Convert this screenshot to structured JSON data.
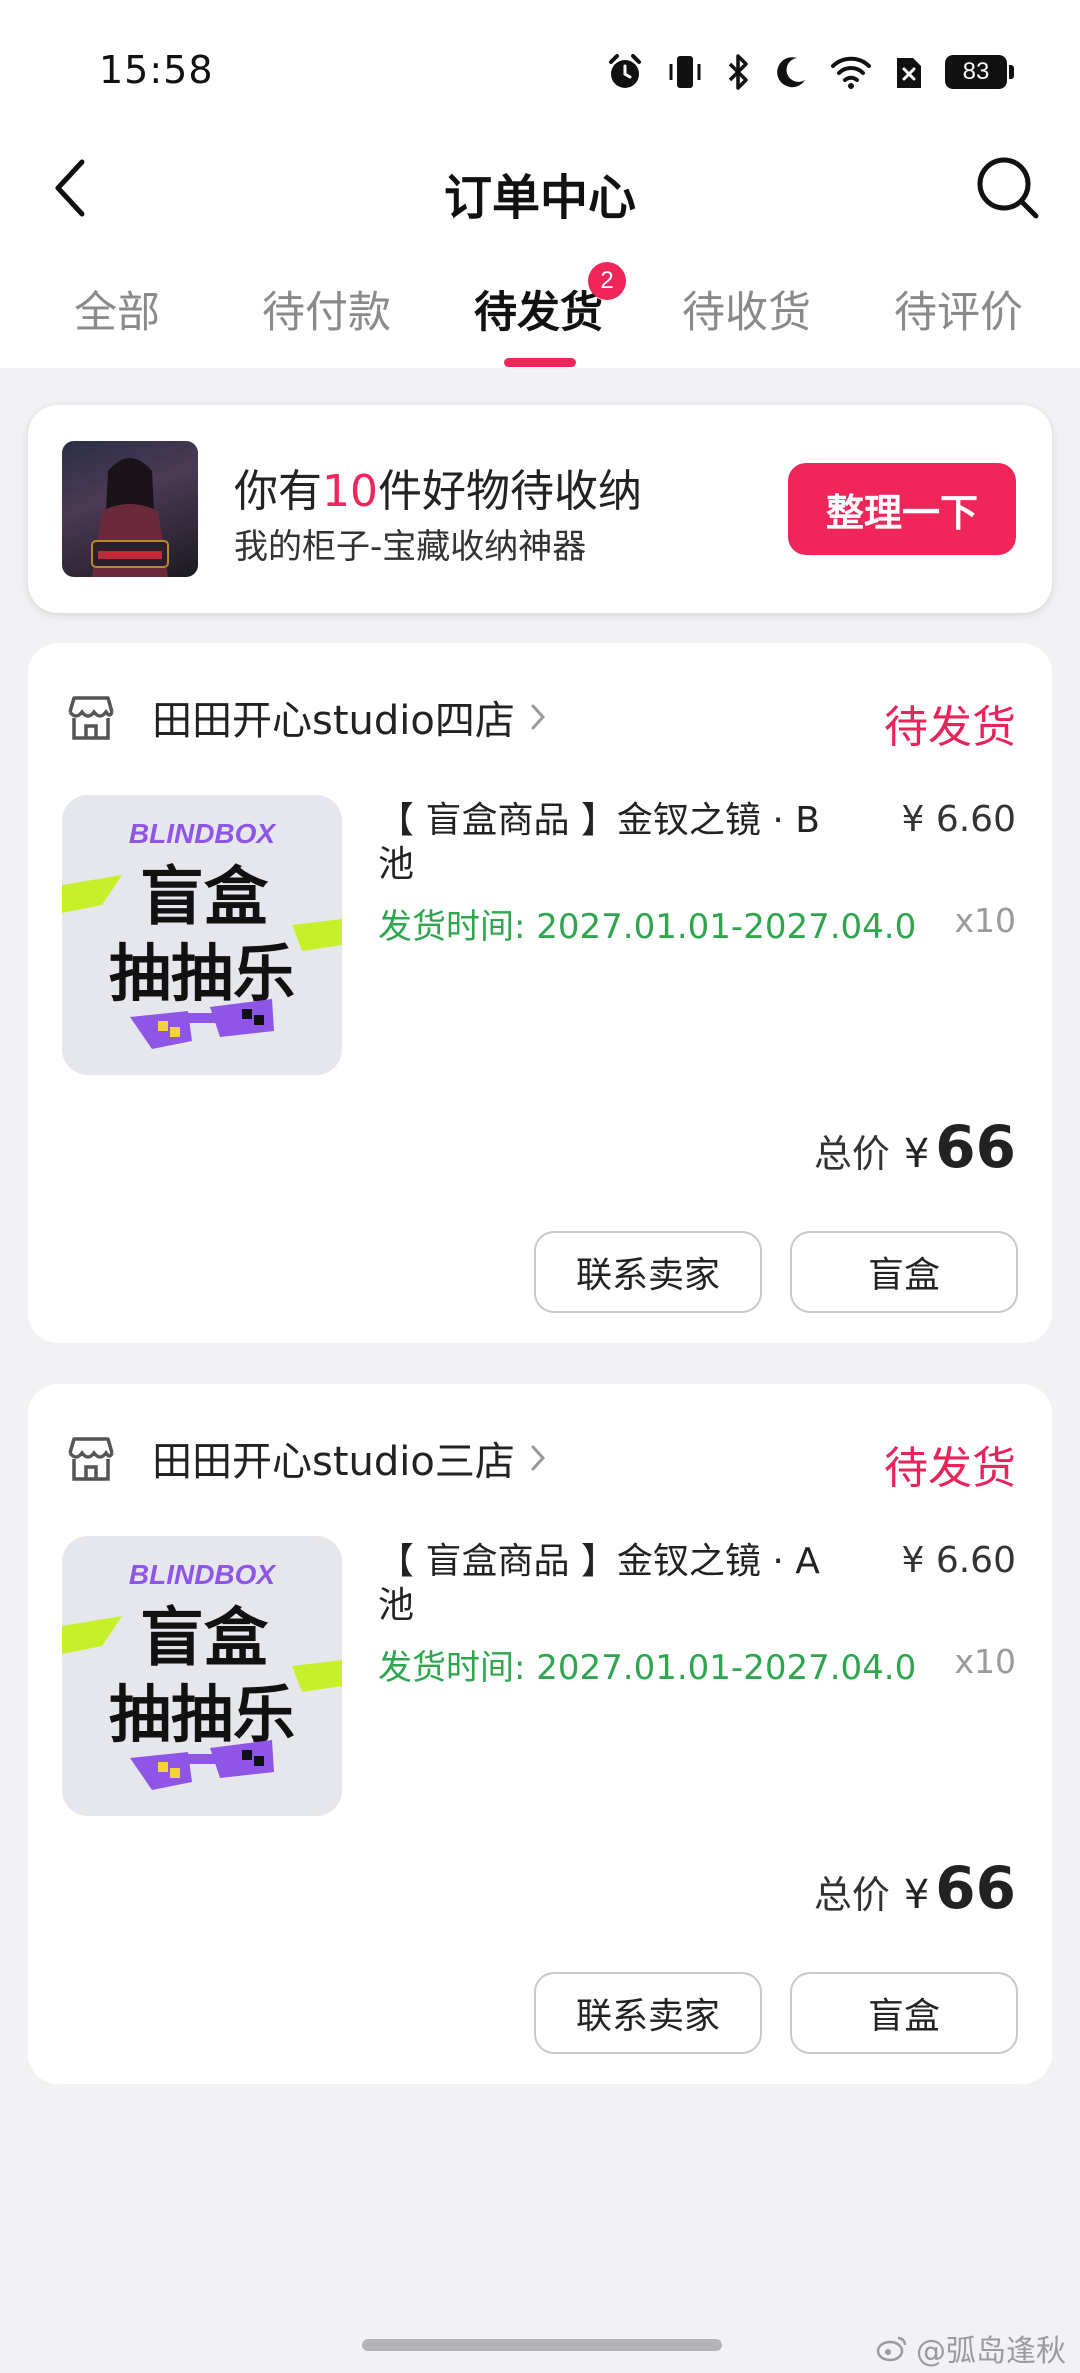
{
  "status_bar": {
    "time": "15:58",
    "battery": "83"
  },
  "header": {
    "title": "订单中心"
  },
  "tabs": {
    "items": [
      {
        "label": "全部"
      },
      {
        "label": "待付款"
      },
      {
        "label": "待发货"
      },
      {
        "label": "待收货"
      },
      {
        "label": "待评价"
      }
    ],
    "active": "待发货",
    "badge": "2"
  },
  "banner": {
    "title_prefix": "你有",
    "title_count": "10",
    "title_suffix": "件好物待收纳",
    "subtitle": "我的柜子-宝藏收纳神器",
    "button_label": "整理一下"
  },
  "orders": [
    {
      "store_name": "田田开心studio四店",
      "status": "待发货",
      "product_title": "【 盲盒商品 】金钗之镜 · B 池",
      "price": "¥ 6.60",
      "ship_time": "发货时间: 2027.01.01-2027.04.0···",
      "quantity": "x10",
      "total_label": "总价",
      "total_currency": "¥",
      "total_amount": "66",
      "contact_label": "联系卖家",
      "blindbox_label": "盲盒"
    },
    {
      "store_name": "田田开心studio三店",
      "status": "待发货",
      "product_title": "【 盲盒商品 】金钗之镜 · A 池",
      "price": "¥ 6.60",
      "ship_time": "发货时间: 2027.01.01-2027.04.0···",
      "quantity": "x10",
      "total_label": "总价",
      "total_currency": "¥",
      "total_amount": "66",
      "contact_label": "联系卖家",
      "blindbox_label": "盲盒"
    }
  ],
  "product_image": {
    "brand": "BLINDBOX",
    "line1": "盲盒",
    "line2": "抽抽乐"
  },
  "watermark": "@弧岛逢秋",
  "colors": {
    "accent": "#f0265a",
    "status": "#e8245a",
    "ship_time": "#2fa54e",
    "blindbox_purple": "#8e55e6"
  }
}
